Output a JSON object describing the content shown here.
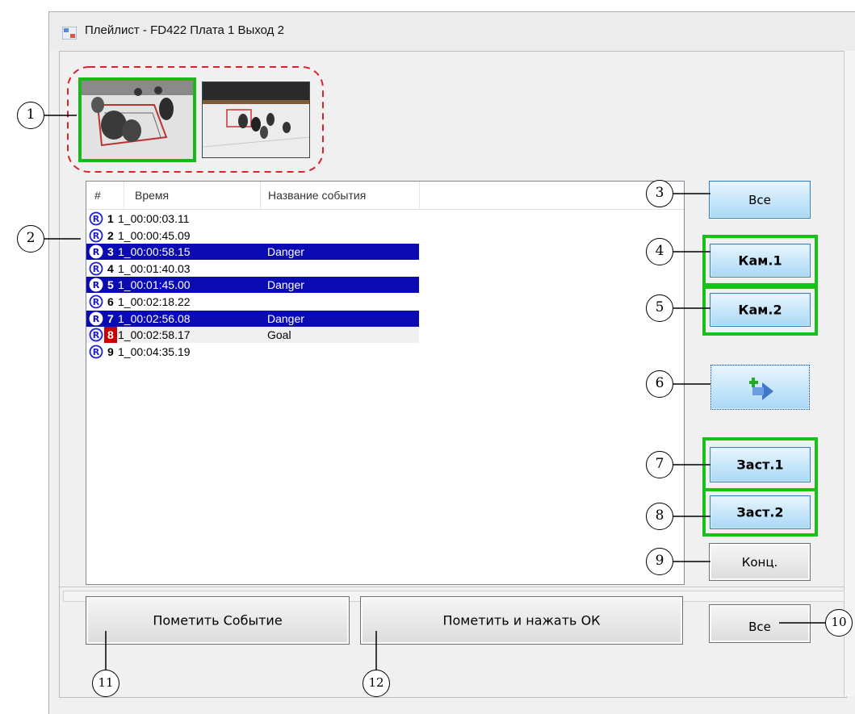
{
  "window": {
    "title": "Плейлист - FD422 Плата 1 Выход 2",
    "icon": "playlist-app-icon"
  },
  "thumbnails": [
    {
      "name": "camera-1-preview",
      "selected": true
    },
    {
      "name": "camera-2-preview",
      "selected": false
    }
  ],
  "list": {
    "columns": [
      "#",
      "Время",
      "Название события"
    ],
    "rows": [
      {
        "num": "1",
        "time": "1_00:00:03.11",
        "name": "",
        "state": "normal"
      },
      {
        "num": "2",
        "time": "1_00:00:45.09",
        "name": "",
        "state": "normal"
      },
      {
        "num": "3",
        "time": "1_00:00:58.15",
        "name": "Danger",
        "state": "selected"
      },
      {
        "num": "4",
        "time": "1_00:01:40.03",
        "name": "",
        "state": "normal"
      },
      {
        "num": "5",
        "time": "1_00:01:45.00",
        "name": "Danger",
        "state": "selected"
      },
      {
        "num": "6",
        "time": "1_00:02:18.22",
        "name": "",
        "state": "normal"
      },
      {
        "num": "7",
        "time": "1_00:02:56.08",
        "name": "Danger",
        "state": "selected"
      },
      {
        "num": "8",
        "time": "1_00:02:58.17",
        "name": "Goal",
        "state": "current"
      },
      {
        "num": "9",
        "time": "1_00:04:35.19",
        "name": "",
        "state": "normal"
      }
    ]
  },
  "buttons": {
    "all_top": "Все",
    "cam1": "Кам.1",
    "cam2": "Кам.2",
    "add_icon": "add-arrow-icon",
    "zast1": "Заст.1",
    "zast2": "Заст.2",
    "end": "Конц.",
    "all_bottom": "Все",
    "mark_event": "Пометить Событие",
    "mark_ok": "Пометить и нажать ОК"
  },
  "callouts": [
    "1",
    "2",
    "3",
    "4",
    "5",
    "6",
    "7",
    "8",
    "9",
    "10",
    "11",
    "12"
  ],
  "colors": {
    "selection": "#0b0bb3",
    "current_marker": "#c80000",
    "highlight_frame": "#19c019",
    "callout_dash": "#d8232a",
    "button_blue": "#a9d8f6"
  }
}
